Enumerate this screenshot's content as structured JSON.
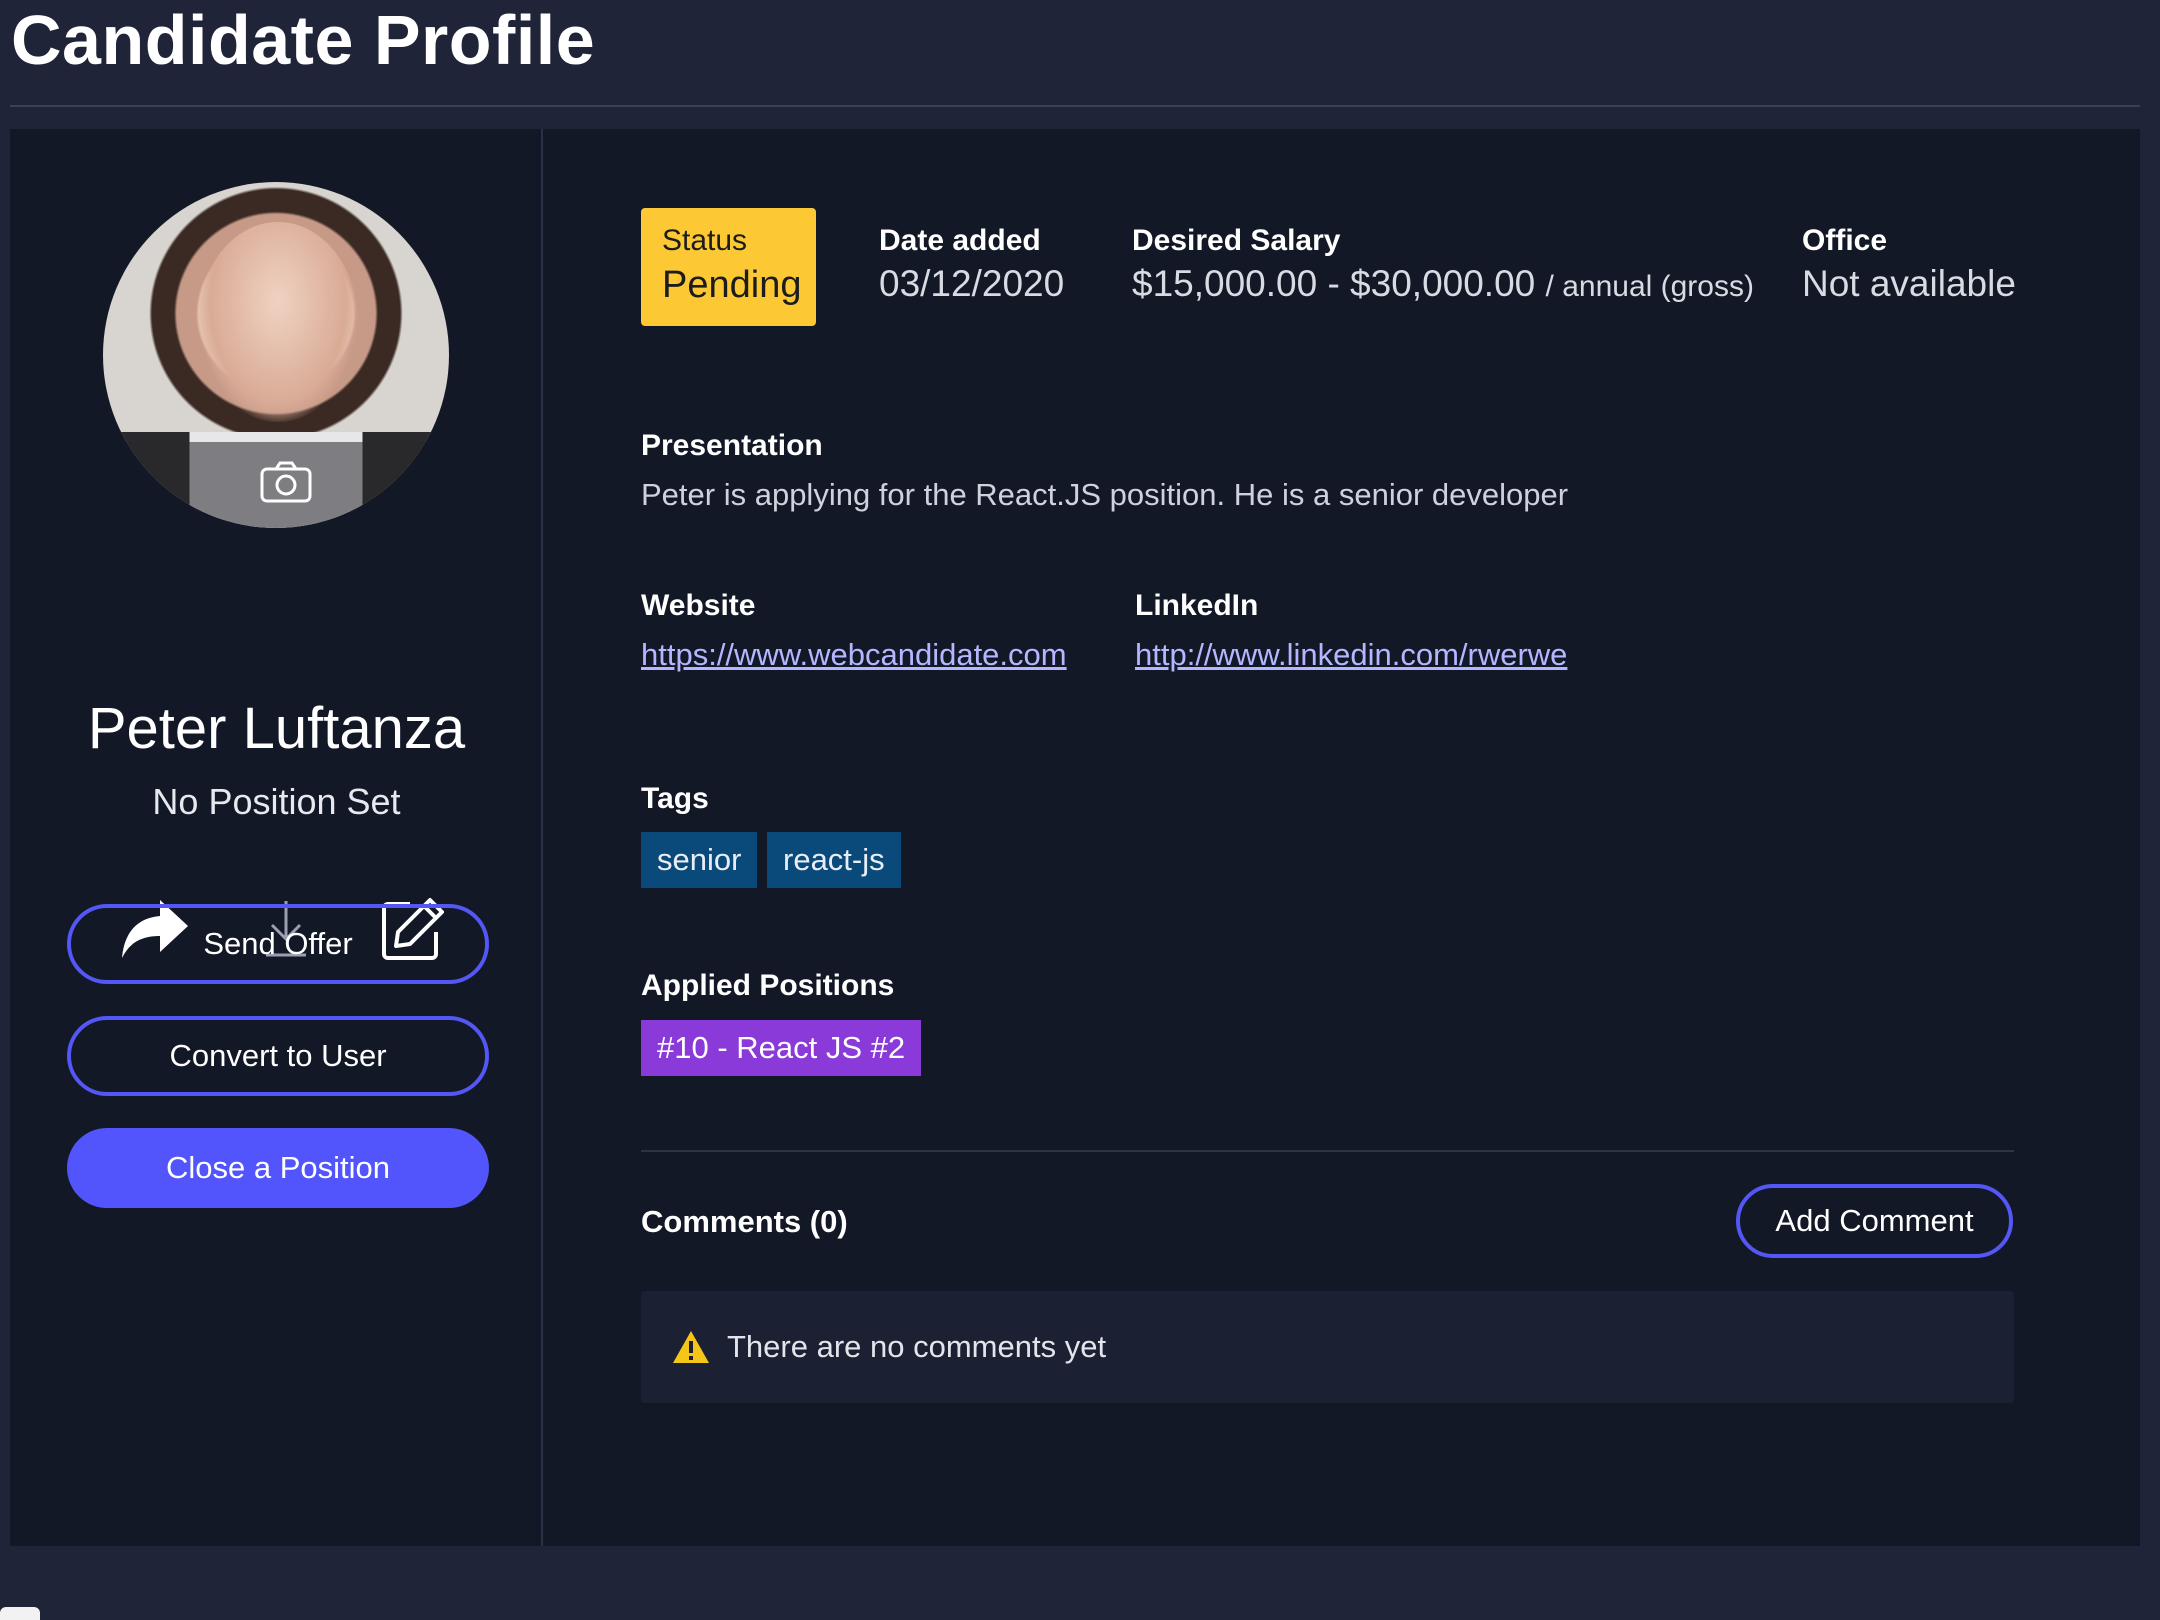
{
  "page": {
    "title": "Candidate Profile"
  },
  "candidate": {
    "name": "Peter Luftanza",
    "position": "No Position Set"
  },
  "actions": {
    "send_offer": "Send Offer",
    "convert_to_user": "Convert to User",
    "close_position": "Close a Position"
  },
  "icons": {
    "camera": "camera-icon",
    "share": "share-icon",
    "download": "download-icon",
    "edit": "edit-icon",
    "warning": "warning-icon"
  },
  "status": {
    "label": "Status",
    "value": "Pending"
  },
  "date_added": {
    "label": "Date added",
    "value": "03/12/2020"
  },
  "salary": {
    "label": "Desired Salary",
    "range": "$15,000.00 - $30,000.00",
    "suffix": "/ annual (gross)"
  },
  "office": {
    "label": "Office",
    "value": "Not available"
  },
  "presentation": {
    "label": "Presentation",
    "text": "Peter is applying for the React.JS position. He is a senior developer"
  },
  "website": {
    "label": "Website",
    "url": "https://www.webcandidate.com"
  },
  "linkedin": {
    "label": "LinkedIn",
    "url": "http://www.linkedin.com/rwerwe"
  },
  "tags": {
    "label": "Tags",
    "items": [
      "senior",
      "react-js"
    ]
  },
  "applied_positions": {
    "label": "Applied Positions",
    "items": [
      "#10 - React JS #2"
    ]
  },
  "comments": {
    "label": "Comments (0)",
    "add_button": "Add Comment",
    "empty_text": "There are no comments yet"
  },
  "colors": {
    "background": "#1f2438",
    "card": "#131827",
    "accent": "#5255fb",
    "status": "#fcc934",
    "tag": "#0a4a7a",
    "position_tag": "#8a3ad9",
    "link": "#b4b7ff"
  }
}
